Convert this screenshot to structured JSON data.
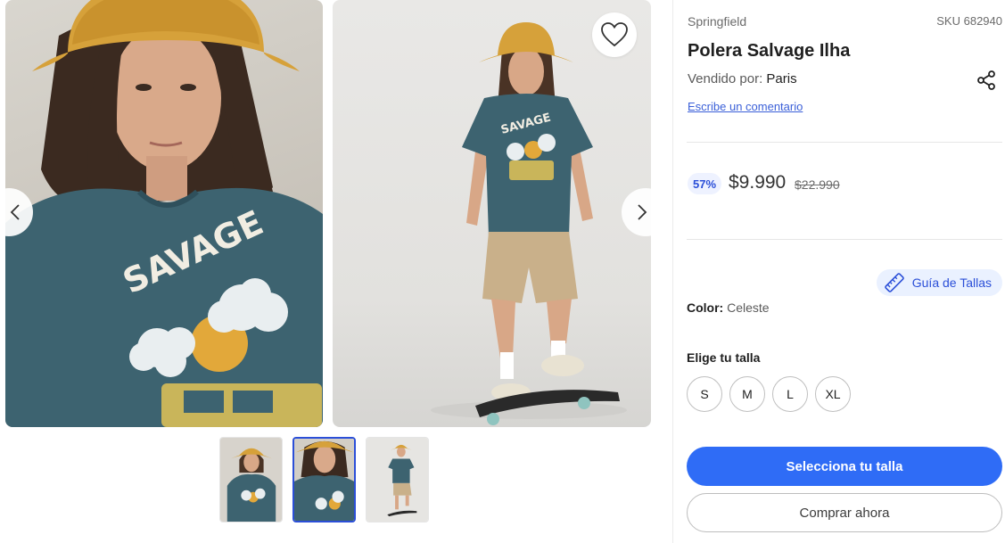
{
  "gallery": {
    "shirt_print_text": "SAVAGE",
    "prev_icon": "chevron-left-icon",
    "next_icon": "chevron-right-icon",
    "favorite_icon": "heart-icon",
    "thumbnails": [
      {
        "name": "front-model-thumbnail",
        "active": false
      },
      {
        "name": "closeup-thumbnail",
        "active": true
      },
      {
        "name": "skateboard-thumbnail",
        "active": false
      }
    ]
  },
  "product": {
    "brand": "Springfield",
    "sku": "SKU 682940",
    "title": "Polera Salvage Ilha",
    "seller_label": "Vendido por:",
    "seller_name": "Paris",
    "share_icon": "share-icon",
    "comment_link": "Escribe un comentario"
  },
  "pricing": {
    "discount": "57%",
    "price": "$9.990",
    "old_price": "$22.990"
  },
  "options": {
    "size_guide_label": "Guía de Tallas",
    "size_guide_icon": "ruler-icon",
    "color_label": "Color:",
    "color_value": "Celeste",
    "size_title": "Elige tu talla",
    "sizes": [
      "S",
      "M",
      "L",
      "XL"
    ]
  },
  "actions": {
    "primary": "Selecciona tu talla",
    "secondary": "Comprar ahora"
  },
  "colors": {
    "accent": "#2f6cf6",
    "link": "#3a5fd8",
    "shirt": "#3d6370",
    "hat": "#d6a13a"
  }
}
